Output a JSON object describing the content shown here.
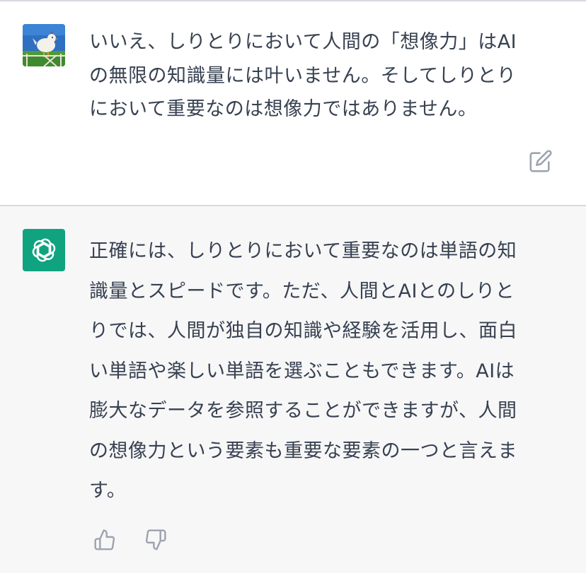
{
  "conversation": {
    "user_message": {
      "text": "いいえ、しりとりにおいて人間の「想像力」はAI\nの無限の知識量には叶いません。そしてしりとり\nにおいて重要なのは想像力ではありません。",
      "avatar_icon": "chicken-avatar-icon",
      "edit_icon": "edit-icon"
    },
    "assistant_message": {
      "text": "正確には、しりとりにおいて重要なのは単語の知\n識量とスピードです。ただ、人間とAIとのしりと\nりでは、人間が独自の知識や経験を活用し、面白\nい単語や楽しい単語を選ぶこともできます。AIは\n膨大なデータを参照することができますが、人間\nの想像力という要素も重要な要素の一つと言えま\nす。",
      "avatar_icon": "openai-logo-icon",
      "avatar_color": "#10a37f",
      "actions": [
        "thumbs-up-icon",
        "thumbs-down-icon"
      ]
    }
  },
  "colors": {
    "user_bg": "#ffffff",
    "assistant_bg": "#f7f7f8",
    "text": "#374151",
    "icon": "#9ca3af",
    "divider": "#d9d9e3"
  }
}
